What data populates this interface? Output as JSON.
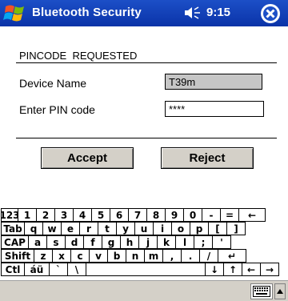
{
  "titlebar": {
    "title": "Bluetooth Security",
    "time": "9:15"
  },
  "dialog": {
    "heading": "PINCODE  REQUESTED",
    "device_label": "Device Name",
    "device_value": "T39m",
    "pin_label": "Enter PIN code",
    "pin_value": "****"
  },
  "buttons": {
    "accept": "Accept",
    "reject": "Reject"
  },
  "keyboard": {
    "rows": [
      [
        "123",
        "1",
        "2",
        "3",
        "4",
        "5",
        "6",
        "7",
        "8",
        "9",
        "0",
        "-",
        "=",
        "←"
      ],
      [
        "Tab",
        "q",
        "w",
        "e",
        "r",
        "t",
        "y",
        "u",
        "i",
        "o",
        "p",
        "[",
        "]"
      ],
      [
        "CAP",
        "a",
        "s",
        "d",
        "f",
        "g",
        "h",
        "j",
        "k",
        "l",
        ";",
        "'"
      ],
      [
        "Shift",
        "z",
        "x",
        "c",
        "v",
        "b",
        "n",
        "m",
        ",",
        ".",
        "/",
        "↵"
      ],
      [
        "Ctl",
        "áü",
        "`",
        "\\",
        "",
        "↓",
        "↑",
        "←",
        "→"
      ]
    ]
  },
  "icons": {
    "start": "windows-flag-icon",
    "volume": "speaker-icon",
    "close": "close-icon",
    "keyboard_toggle": "keyboard-icon"
  }
}
